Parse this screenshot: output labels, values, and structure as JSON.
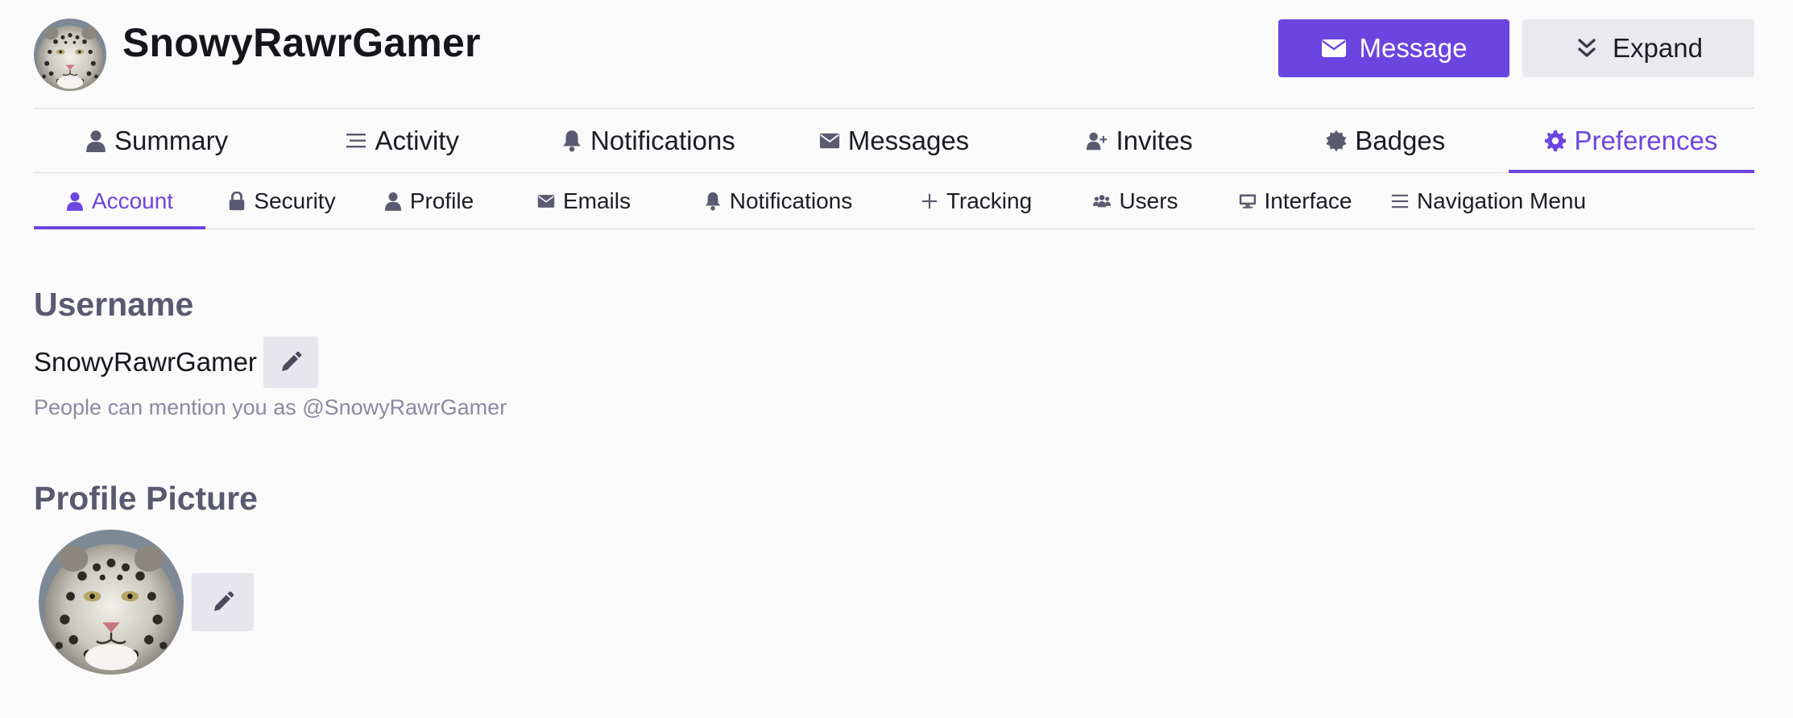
{
  "header": {
    "username": "SnowyRawrGamer",
    "message_label": "Message",
    "expand_label": "Expand",
    "avatar_icon": "snow-leopard-avatar",
    "accent_color": "#6c45e0"
  },
  "primary_tabs": [
    {
      "label": "Summary",
      "icon": "user-icon"
    },
    {
      "label": "Activity",
      "icon": "list-icon"
    },
    {
      "label": "Notifications",
      "icon": "bell-icon"
    },
    {
      "label": "Messages",
      "icon": "envelope-icon"
    },
    {
      "label": "Invites",
      "icon": "user-plus-icon"
    },
    {
      "label": "Badges",
      "icon": "badge-icon"
    },
    {
      "label": "Preferences",
      "icon": "gear-icon",
      "active": true
    }
  ],
  "sub_tabs": [
    {
      "label": "Account",
      "icon": "user-icon",
      "active": true
    },
    {
      "label": "Security",
      "icon": "lock-icon"
    },
    {
      "label": "Profile",
      "icon": "user-icon"
    },
    {
      "label": "Emails",
      "icon": "envelope-icon"
    },
    {
      "label": "Notifications",
      "icon": "bell-icon"
    },
    {
      "label": "Tracking",
      "icon": "plus-icon"
    },
    {
      "label": "Users",
      "icon": "users-icon"
    },
    {
      "label": "Interface",
      "icon": "desktop-icon"
    },
    {
      "label": "Navigation Menu",
      "icon": "bars-icon"
    }
  ],
  "account": {
    "username_heading": "Username",
    "username_value": "SnowyRawrGamer",
    "mention_hint": "People can mention you as @SnowyRawrGamer",
    "picture_heading": "Profile Picture"
  }
}
